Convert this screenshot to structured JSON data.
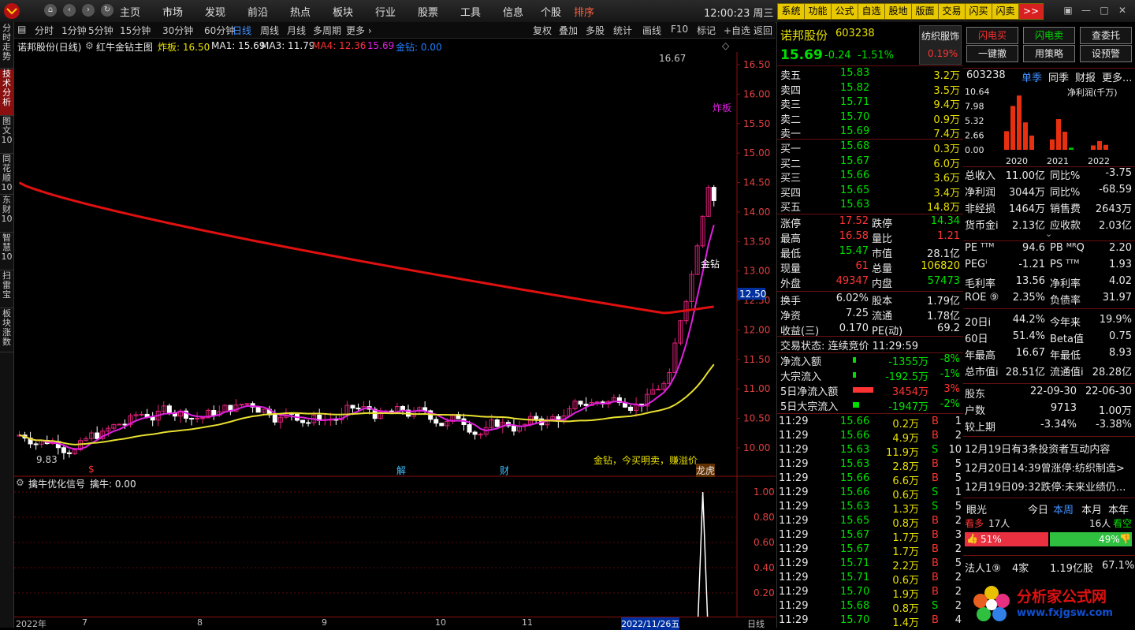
{
  "topbar": {
    "menus": [
      "主页",
      "市场",
      "发现",
      "前沿",
      "热点",
      "板块",
      "行业",
      "股票",
      "工具",
      "信息",
      "个股",
      "排序"
    ],
    "time": "12:00:23 周三",
    "tool_buttons": [
      "系统",
      "功能",
      "公式",
      "自选",
      "股地",
      "版面",
      "交易",
      "闪买",
      "闪卖",
      ">>"
    ],
    "window_buttons": [
      "▣",
      "—",
      "□",
      "✕"
    ]
  },
  "left_tabs": [
    "分时走势",
    "技术分析",
    "图文10",
    "同花顺10",
    "东财10",
    "智慧10",
    "扫雷宝",
    "板块涨数"
  ],
  "chart_toolbar": {
    "periods": [
      "分时",
      "1分钟",
      "5分钟",
      "15分钟",
      "30分钟",
      "60分钟",
      "日线",
      "周线",
      "月线",
      "多周期",
      "更多 ›"
    ],
    "actions": [
      "复权",
      "叠加",
      "多股",
      "统计",
      "画线",
      "F10",
      "标记",
      "+自选",
      "返回"
    ]
  },
  "info_line": {
    "stock": "诺邦股份(日线)",
    "indicator": "红牛金钻主图",
    "zhaban": "炸板: 16.50",
    "ma1": "MA1: 15.69",
    "ma3": "MA3: 11.79",
    "ma4": "MA4: 12.36",
    "v15": ": 15.69",
    "jinzuan": "金钻: 0.00"
  },
  "main_chart": {
    "price_axis": [
      "16.50",
      "16.00",
      "15.50",
      "15.00",
      "14.50",
      "14.00",
      "13.50",
      "13.00",
      "12.50",
      "12.00",
      "11.50",
      "11.00",
      "10.50",
      "10.00"
    ],
    "current_price_marker": "12.50",
    "high_label": "16.67",
    "low_label": "9.83",
    "zhaban_label": "炸板",
    "jinzuan_label": "金钻",
    "signal_text": "金钻，今买明卖，赚溢价",
    "event_labels": [
      "$",
      "解",
      "财",
      "龙虎"
    ],
    "series_colors": {
      "ma_long": "#e01010",
      "ma_yellow": "#e8e030",
      "ma_magenta": "#e020e0",
      "up_candle": "#e0207a",
      "down_candle": "#ffffff"
    }
  },
  "sub_chart": {
    "title": "擒牛优化信号",
    "value": "擒牛: 0.00",
    "axis": [
      "1.00",
      "0.80",
      "0.60",
      "0.40",
      "0.20"
    ],
    "spike_value": 1.0
  },
  "date_axis": [
    "2022年",
    "7",
    "8",
    "9",
    "10",
    "11",
    "2022/11/26五",
    "日线"
  ],
  "quote": {
    "name": "诺邦股份",
    "code": "603238",
    "industry": "纺织服饰",
    "price": "15.69",
    "change": "-0.24",
    "pct": "-1.51%",
    "turnover_badge": "0.19%",
    "asks": [
      {
        "label": "卖五",
        "price": "15.83",
        "vol": "3.2万"
      },
      {
        "label": "卖四",
        "price": "15.82",
        "vol": "3.5万"
      },
      {
        "label": "卖三",
        "price": "15.71",
        "vol": "9.4万"
      },
      {
        "label": "卖二",
        "price": "15.70",
        "vol": "0.9万"
      },
      {
        "label": "卖一",
        "price": "15.69",
        "vol": "7.4万"
      }
    ],
    "bids": [
      {
        "label": "买一",
        "price": "15.68",
        "vol": "0.3万"
      },
      {
        "label": "买二",
        "price": "15.67",
        "vol": "6.0万"
      },
      {
        "label": "买三",
        "price": "15.66",
        "vol": "3.6万"
      },
      {
        "label": "买四",
        "price": "15.65",
        "vol": "3.4万"
      },
      {
        "label": "买五",
        "price": "15.63",
        "vol": "14.8万"
      }
    ],
    "stats1": [
      {
        "l1": "涨停",
        "v1": "17.52",
        "l2": "跌停",
        "v2": "14.34"
      },
      {
        "l1": "最高",
        "v1": "16.58",
        "l2": "量比",
        "v2": "1.21"
      },
      {
        "l1": "最低",
        "v1": "15.47",
        "l2": "市值",
        "v2": "28.1亿"
      },
      {
        "l1": "现量",
        "v1": "61",
        "l2": "总量",
        "v2": "106820"
      },
      {
        "l1": "外盘",
        "v1": "49347",
        "l2": "内盘",
        "v2": "57473"
      }
    ],
    "stats2": [
      {
        "l1": "换手",
        "v1": "6.02%",
        "l2": "股本",
        "v2": "1.79亿"
      },
      {
        "l1": "净资",
        "v1": "7.25",
        "l2": "流通",
        "v2": "1.78亿"
      },
      {
        "l1": "收益(三)",
        "v1": "0.170",
        "l2": "PE(动)",
        "v2": "69.2"
      }
    ],
    "status": "交易状态: 连续竞价 11:29:59",
    "flows": [
      {
        "label": "净流入额",
        "value": "-1355万",
        "pct": "-8%",
        "bar": 0.1
      },
      {
        "label": "大宗流入",
        "value": "-192.5万",
        "pct": "-1%",
        "bar": 0.02
      },
      {
        "label": "5日净流入额",
        "value": "3454万",
        "pct": "3%",
        "bar": 1.0
      },
      {
        "label": "5日大宗流入",
        "value": "-1947万",
        "pct": "-2%",
        "bar": 0.3
      }
    ],
    "ticks": [
      {
        "t": "11:29",
        "p": "15.66",
        "v": "0.2万",
        "d": "B",
        "n": "1"
      },
      {
        "t": "11:29",
        "p": "15.66",
        "v": "4.9万",
        "d": "B",
        "n": "2"
      },
      {
        "t": "11:29",
        "p": "15.63",
        "v": "11.9万",
        "d": "S",
        "n": "10"
      },
      {
        "t": "11:29",
        "p": "15.63",
        "v": "2.8万",
        "d": "B",
        "n": "5"
      },
      {
        "t": "11:29",
        "p": "15.66",
        "v": "6.6万",
        "d": "B",
        "n": "5"
      },
      {
        "t": "11:29",
        "p": "15.66",
        "v": "0.6万",
        "d": "S",
        "n": "1"
      },
      {
        "t": "11:29",
        "p": "15.63",
        "v": "1.3万",
        "d": "S",
        "n": "5"
      },
      {
        "t": "11:29",
        "p": "15.65",
        "v": "0.8万",
        "d": "B",
        "n": "2"
      },
      {
        "t": "11:29",
        "p": "15.67",
        "v": "1.7万",
        "d": "B",
        "n": "3"
      },
      {
        "t": "11:29",
        "p": "15.67",
        "v": "1.7万",
        "d": "B",
        "n": "2"
      },
      {
        "t": "11:29",
        "p": "15.71",
        "v": "2.2万",
        "d": "B",
        "n": "5"
      },
      {
        "t": "11:29",
        "p": "15.71",
        "v": "0.6万",
        "d": "B",
        "n": "2"
      },
      {
        "t": "11:29",
        "p": "15.70",
        "v": "1.9万",
        "d": "B",
        "n": "2"
      },
      {
        "t": "11:29",
        "p": "15.68",
        "v": "0.8万",
        "d": "S",
        "n": "2"
      },
      {
        "t": "11:29",
        "p": "15.70",
        "v": "1.4万",
        "d": "B",
        "n": "4"
      }
    ]
  },
  "far_right": {
    "buttons": [
      "闪电买",
      "闪电卖",
      "查委托",
      "一键撤",
      "用策略",
      "设预警"
    ],
    "fin_code": "603238",
    "fin_tabs": [
      "单季",
      "同季",
      "财报",
      "更多..."
    ],
    "fin_title": "净利润(千万)",
    "fin_axis": [
      "10.64",
      "7.98",
      "5.32",
      "2.66",
      "0.00"
    ],
    "fin_years": [
      "2020",
      "2021",
      "2022"
    ],
    "fin_bars": [
      3.4,
      8.0,
      9.9,
      5.0,
      2.6,
      1.9,
      5.6,
      3.3,
      0.4,
      0.8,
      1.6,
      0.9
    ],
    "metrics": [
      {
        "l1": "总收入",
        "v1": "11.00亿",
        "l2": "同比%",
        "v2": "-3.75"
      },
      {
        "l1": "净利润",
        "v1": "3044万",
        "l2": "同比%",
        "v2": "-68.59"
      },
      {
        "l1": "非经损",
        "v1": "1464万",
        "l2": "销售费",
        "v2": "2643万"
      },
      {
        "l1": "货币金i",
        "v1": "2.13亿",
        "l2": "应收款",
        "v2": "2.03亿"
      }
    ],
    "ratios": [
      {
        "l1": "PE ᵀᵀᴹ",
        "v1": "94.6",
        "l2": "PB ᴹᴿQ",
        "v2": "2.20"
      },
      {
        "l1": "PEGⁱ",
        "v1": "-1.21",
        "l2": "PS ᵀᵀᴹ",
        "v2": "1.93"
      },
      {
        "l1": "毛利率",
        "v1": "13.56",
        "l2": "净利率",
        "v2": "4.02"
      },
      {
        "l1": "ROE ⑨",
        "v1": "2.35%",
        "l2": "负债率",
        "v2": "31.97"
      }
    ],
    "perf": [
      {
        "l1": "20日i",
        "v1": "44.2%",
        "l2": "今年来",
        "v2": "19.9%"
      },
      {
        "l1": "60日",
        "v1": "51.4%",
        "l2": "Beta值",
        "v2": "0.75"
      },
      {
        "l1": "年最高",
        "v1": "16.67",
        "l2": "年最低",
        "v2": "8.93"
      },
      {
        "l1": "总市值i",
        "v1": "28.51亿",
        "l2": "流通值i",
        "v2": "28.28亿"
      }
    ],
    "holders": [
      {
        "l": "股东",
        "v1": "22-09-30",
        "v2": "22-06-30"
      },
      {
        "l": "户数",
        "v1": "9713",
        "v2": "1.00万"
      },
      {
        "l": "较上期",
        "v1": "-3.34%",
        "v2": "-3.38%"
      }
    ],
    "news": [
      "12月19日有3条投资者互动内容",
      "12月20日14:39曾涨停:纺织制造>",
      "12月19日09:32跌停:未来业绩仍..."
    ],
    "vision": {
      "title": "眼光",
      "tabs": [
        "今日",
        "本周",
        "本月",
        "本年"
      ],
      "bull_label": "看多",
      "bull_count": "17人",
      "bear_count": "16人",
      "bear_label": "看空",
      "bull_pct": "51%",
      "bear_pct": "49%",
      "bull_ratio": 0.51
    },
    "inst": {
      "label": "法人1⑨",
      "count": "4家",
      "shares": "1.19亿股",
      "pct": "67.1%"
    },
    "watermark": "分析家公式网",
    "watermark_url": "www.fxjgsw.com"
  }
}
